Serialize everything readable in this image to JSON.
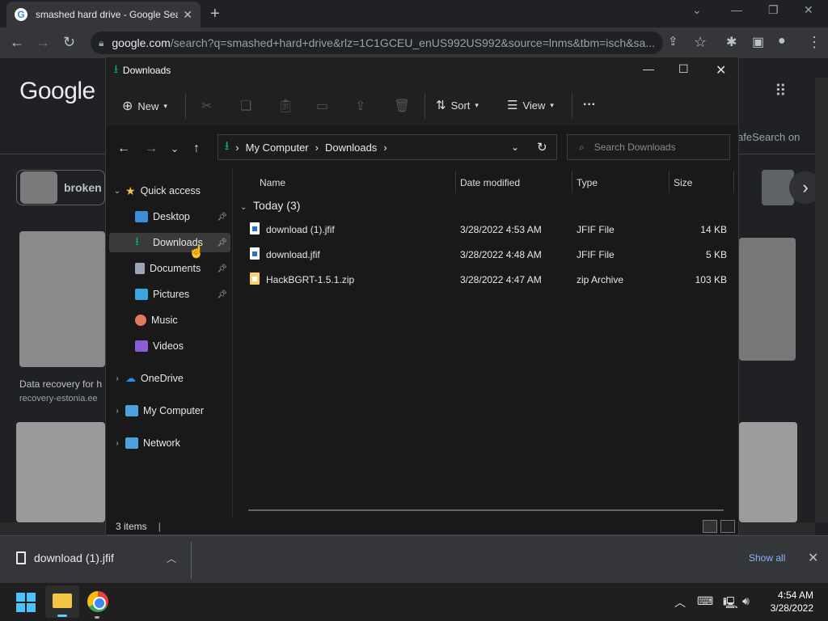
{
  "browser": {
    "tab_title": "smashed hard drive - Google Sea",
    "tab_favicon": "G",
    "url_host": "google.com",
    "url_path": "/search?q=smashed+hard+drive&rlz=1C1GCEU_enUS992US992&source=lnms&tbm=isch&sa..."
  },
  "google": {
    "logo": "Google",
    "chip_label": "broken",
    "safesearch": "afeSearch on",
    "result_caption": "Data recovery for h",
    "result_source": "recovery-estonia.ee"
  },
  "explorer": {
    "title": "Downloads",
    "toolbar": {
      "new_label": "New",
      "sort_label": "Sort",
      "view_label": "View",
      "more_label": "···"
    },
    "address": {
      "segments": [
        "My Computer",
        "Downloads"
      ]
    },
    "search_placeholder": "Search Downloads",
    "nav": {
      "quick_access": "Quick access",
      "desktop": "Desktop",
      "downloads": "Downloads",
      "documents": "Documents",
      "pictures": "Pictures",
      "music": "Music",
      "videos": "Videos",
      "onedrive": "OneDrive",
      "my_computer": "My Computer",
      "network": "Network"
    },
    "columns": {
      "name": "Name",
      "date": "Date modified",
      "type": "Type",
      "size": "Size"
    },
    "group_label": "Today (3)",
    "files": [
      {
        "name": "download (1).jfif",
        "date": "3/28/2022 4:53 AM",
        "type": "JFIF File",
        "size": "14 KB"
      },
      {
        "name": "download.jfif",
        "date": "3/28/2022 4:48 AM",
        "type": "JFIF File",
        "size": "5 KB"
      },
      {
        "name": "HackBGRT-1.5.1.zip",
        "date": "3/28/2022 4:47 AM",
        "type": "zip Archive",
        "size": "103 KB"
      }
    ],
    "status": "3 items"
  },
  "download_shelf": {
    "item": "download (1).jfif",
    "show_all": "Show all"
  },
  "taskbar": {
    "time": "4:54 AM",
    "date": "3/28/2022"
  },
  "colors": {
    "accent_teal": "#00b294",
    "link_blue": "#8ab4f8",
    "selection": "#3a3a3a"
  }
}
